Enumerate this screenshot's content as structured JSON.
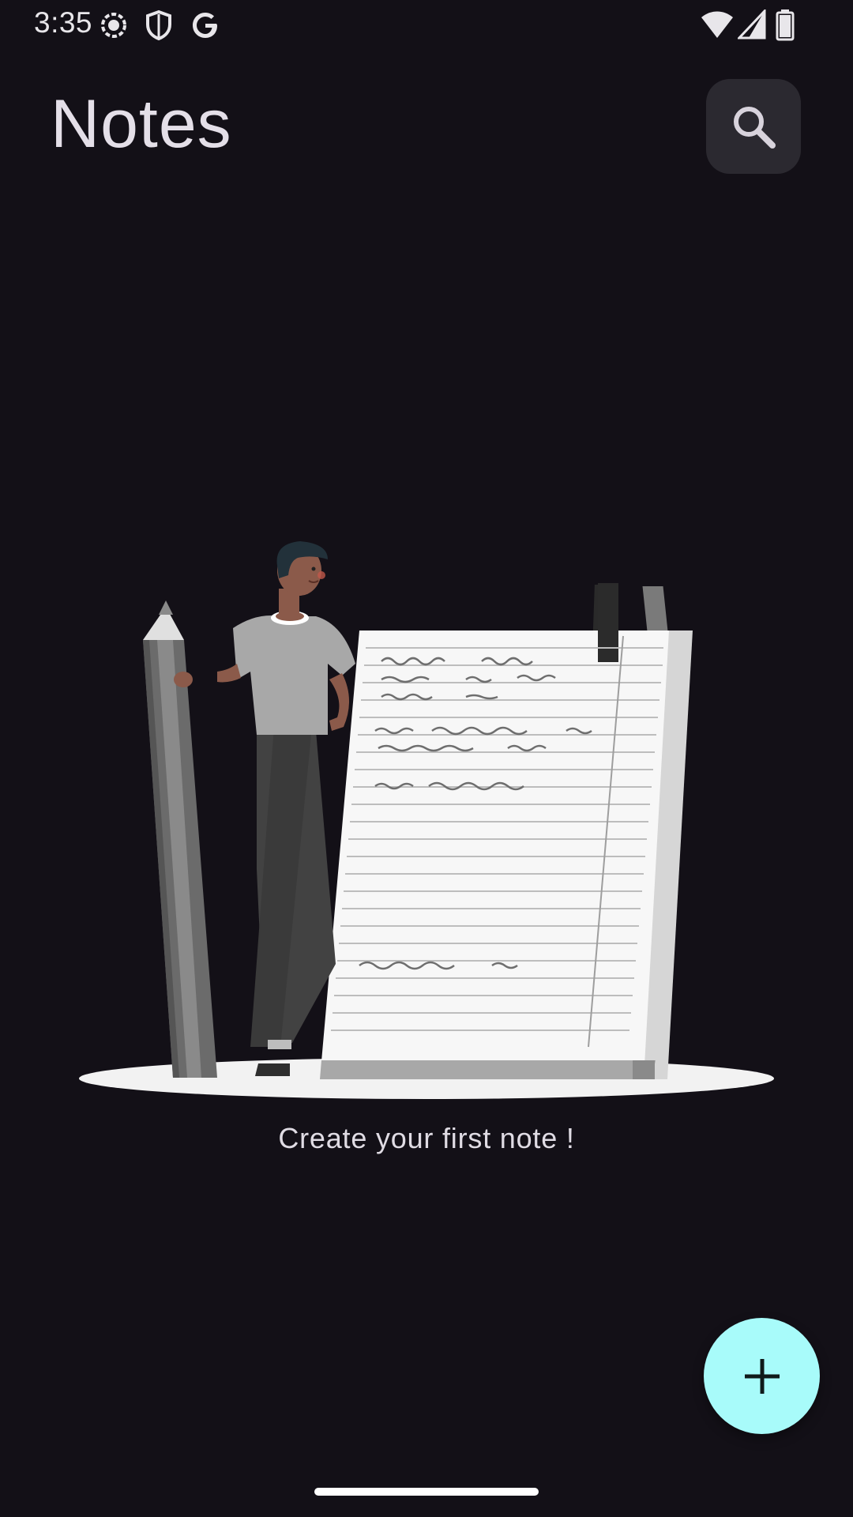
{
  "status_bar": {
    "time": "3:35",
    "left_icons": [
      "screen-record-icon",
      "shield-icon",
      "google-icon"
    ],
    "right_icons": [
      "wifi-icon",
      "signal-icon",
      "battery-icon"
    ]
  },
  "header": {
    "title": "Notes",
    "search_icon": "search-icon"
  },
  "empty_state": {
    "illustration": "person-with-pencil-and-notepad-illustration",
    "message": "Create your first note !"
  },
  "fab": {
    "icon": "plus-icon"
  },
  "colors": {
    "background": "#131017",
    "search_button_bg": "#2b2930",
    "fab_bg": "#a8fbfa",
    "title_text": "#e4dfe8"
  }
}
